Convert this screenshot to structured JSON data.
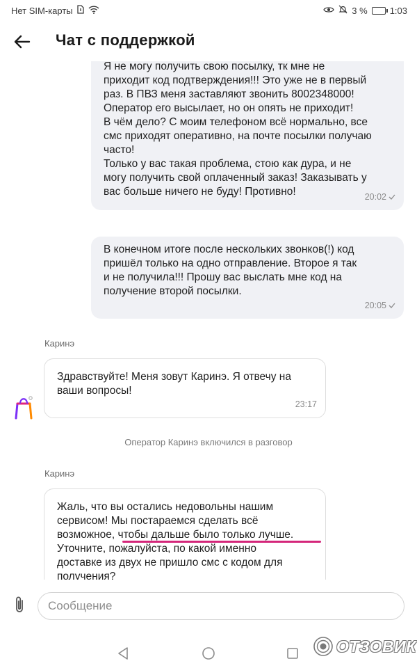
{
  "status_bar": {
    "carrier": "Нет SIM-карты",
    "battery_percent": "3 %",
    "time": "1:03"
  },
  "header": {
    "title": "Чат с поддержкой"
  },
  "messages": [
    {
      "type": "outgoing",
      "lines": [
        "Я не могу получить свою посылку, тк мне не",
        "приходит код подтверждения!!! Это уже не в первый",
        "раз. В ПВЗ меня заставляют звонить 8002348000!",
        "Оператор его высылает, но он опять не приходит!",
        "В чём дело? С моим телефоном всё нормально, все",
        "смс приходят оперативно, на почте посылки получаю",
        "часто!",
        "Только у вас такая проблема, стою как дура, и не",
        "могу получить свой оплаченный заказ! Заказывать у",
        "вас больше ничего не буду! Противно!"
      ],
      "time": "20:02"
    },
    {
      "type": "outgoing",
      "lines": [
        "В конечном итоге после нескольких звонков(!) код",
        "пришёл только на одно отправление. Второе я так",
        "и не получила!!! Прошу вас выслать мне код на",
        "получение второй посылки."
      ],
      "time": "20:05"
    },
    {
      "type": "incoming",
      "sender": "Каринэ",
      "lines": [
        "Здравствуйте! Меня зовут Каринэ. Я отвечу на",
        "ваши вопросы!"
      ],
      "time": "23:17"
    },
    {
      "type": "system",
      "text": "Оператор Каринэ включился в разговор"
    },
    {
      "type": "incoming",
      "sender": "Каринэ",
      "lines": [
        "Жаль, что вы остались недовольны нашим",
        "сервисом! Мы постараемся сделать всё",
        "возможное, чтобы дальше было только лучше.",
        "Уточните, пожалуйста, по какой именно",
        "доставке из двух не пришло смс с кодом для",
        "получения?"
      ]
    }
  ],
  "input": {
    "placeholder": "Сообщение"
  },
  "watermark": {
    "text": "ОТЗОВИК"
  },
  "colors": {
    "outgoing_bubble": "#f0f1f5",
    "incoming_border": "#dedede",
    "highlight_underline": "#d4267a",
    "logo_purple": "#7b2ff7",
    "logo_orange": "#ff8a00"
  }
}
